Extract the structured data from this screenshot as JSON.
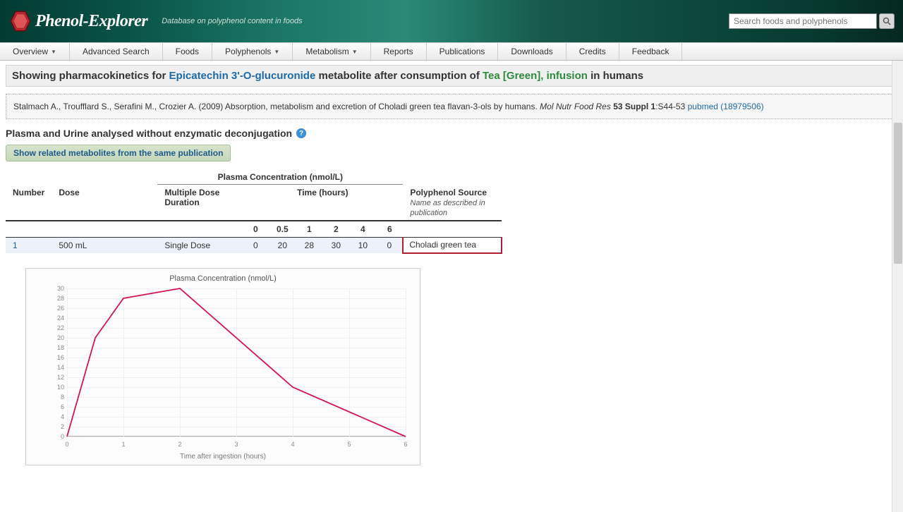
{
  "header": {
    "logo_text": "Phenol-Explorer",
    "tagline": "Database on polyphenol content in foods",
    "search_placeholder": "Search foods and polyphenols"
  },
  "menu": {
    "overview": "Overview",
    "advanced": "Advanced Search",
    "foods": "Foods",
    "polyphenols": "Polyphenols",
    "metabolism": "Metabolism",
    "reports": "Reports",
    "publications": "Publications",
    "downloads": "Downloads",
    "credits": "Credits",
    "feedback": "Feedback"
  },
  "title": {
    "prefix": "Showing pharmacokinetics for ",
    "compound": "Epicatechin 3'-O-glucuronide",
    "mid": " metabolite after consumption of ",
    "source": "Tea [Green], infusion",
    "suffix": " in humans"
  },
  "citation": {
    "authors": "Stalmach A., Troufflard S., Serafini M., Crozier A. (2009) Absorption, metabolism and excretion of Choladi green tea flavan-3-ols by humans. ",
    "journal": "Mol Nutr Food Res",
    "volume": " 53 Suppl 1",
    "pages": ":S44-53 ",
    "pubmed": "pubmed (18979506)"
  },
  "section": {
    "analysis_title": "Plasma and Urine analysed without enzymatic deconjugation",
    "related_btn": "Show related metabolites from the same publication"
  },
  "table": {
    "super": "Plasma Concentration (nmol/L)",
    "h_number": "Number",
    "h_dose": "Dose",
    "h_multi": "Multiple Dose Duration",
    "h_time": "Time (hours)",
    "h_source": "Polyphenol Source",
    "h_source_sub": "Name as described in publication",
    "times": [
      "0",
      "0.5",
      "1",
      "2",
      "4",
      "6"
    ],
    "row": {
      "number": "1",
      "dose": "500 mL",
      "multi": "Single Dose",
      "vals": [
        "0",
        "20",
        "28",
        "30",
        "10",
        "0"
      ],
      "source": "Choladi green tea"
    }
  },
  "chart_data": {
    "type": "line",
    "title": "Plasma Concentration (nmol/L)",
    "xlabel": "Time after ingestion (hours)",
    "ylabel": "",
    "x": [
      0,
      0.5,
      1,
      2,
      4,
      6
    ],
    "y": [
      0,
      20,
      28,
      30,
      10,
      0
    ],
    "xlim": [
      0,
      6
    ],
    "ylim": [
      0,
      30
    ],
    "y_ticks": [
      0,
      2,
      4,
      6,
      8,
      10,
      12,
      14,
      16,
      18,
      20,
      22,
      24,
      26,
      28,
      30
    ],
    "x_ticks": [
      0,
      1,
      2,
      3,
      4,
      5,
      6
    ]
  }
}
